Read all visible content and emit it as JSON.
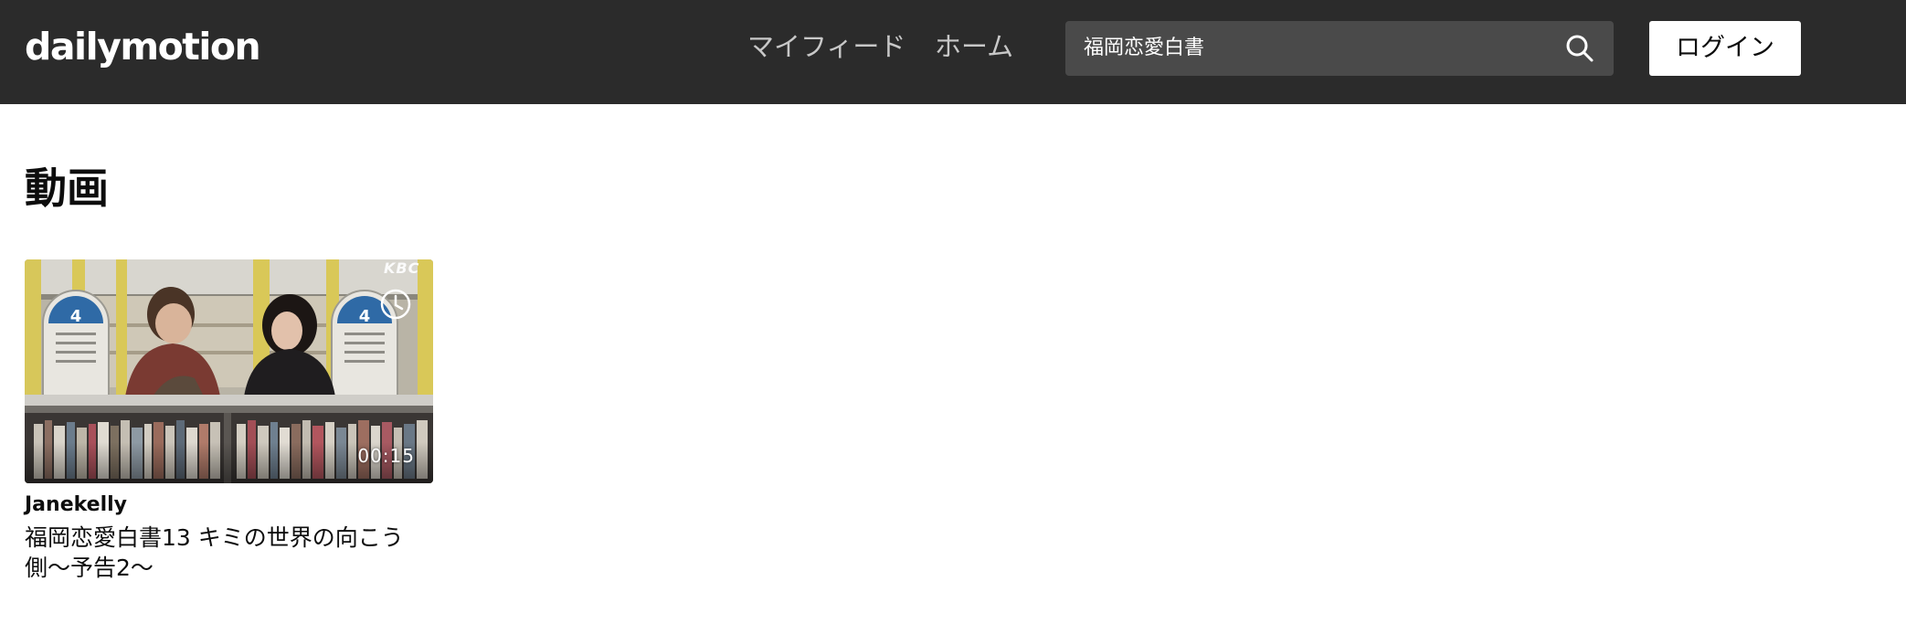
{
  "header": {
    "logo": "dailymotion",
    "nav": {
      "feed_label": "マイフィード",
      "home_label": "ホーム"
    },
    "search": {
      "value": "福岡恋愛白書",
      "icon": "search-icon"
    },
    "login_label": "ログイン",
    "background": "#2b2b2b"
  },
  "main": {
    "section_title": "動画",
    "videos": [
      {
        "owner": "Janekelly",
        "title": "福岡恋愛白書13 キミの世界の向こう側〜予告2〜",
        "duration": "00:15",
        "channel_watermark": "KBC",
        "overlay_icon": "clock-icon"
      }
    ]
  }
}
